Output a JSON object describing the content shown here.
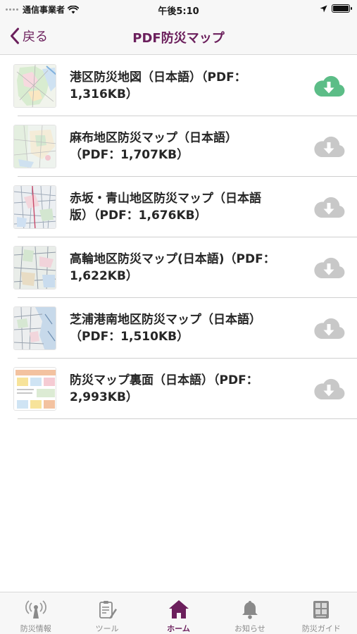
{
  "status_bar": {
    "carrier": "通信事業者",
    "time": "午後5:10"
  },
  "nav": {
    "back_label": "戻る",
    "title": "PDF防災マップ"
  },
  "items": [
    {
      "title_line1": "港区防災地図（日本語）（PDF：",
      "title_line2": "1,316KB）",
      "downloaded": true,
      "thumbnail": "map-thumbnail"
    },
    {
      "title_line1": "麻布地区防災マップ（日本語）",
      "title_line2": "（PDF：1,707KB）",
      "downloaded": false,
      "thumbnail": "map-thumbnail"
    },
    {
      "title_line1": "赤坂・青山地区防災マップ（日本語",
      "title_line2": "版）（PDF：1,676KB）",
      "downloaded": false,
      "thumbnail": "map-thumbnail"
    },
    {
      "title_line1": "高輪地区防災マップ(日本語)（PDF：",
      "title_line2": "1,622KB）",
      "downloaded": false,
      "thumbnail": "map-thumbnail"
    },
    {
      "title_line1": "芝浦港南地区防災マップ（日本語）",
      "title_line2": "（PDF：1,510KB）",
      "downloaded": false,
      "thumbnail": "map-thumbnail"
    },
    {
      "title_line1": "防災マップ裏面（日本語）（PDF：",
      "title_line2": "2,993KB）",
      "downloaded": false,
      "thumbnail": "leaflet-thumbnail"
    }
  ],
  "tabs": [
    {
      "label": "防災情報",
      "icon": "antenna-icon",
      "active": false
    },
    {
      "label": "ツール",
      "icon": "clipboard-pencil-icon",
      "active": false
    },
    {
      "label": "ホーム",
      "icon": "home-icon",
      "active": true
    },
    {
      "label": "お知らせ",
      "icon": "bell-icon",
      "active": false
    },
    {
      "label": "防災ガイド",
      "icon": "guidebook-icon",
      "active": false
    }
  ],
  "colors": {
    "accent": "#6b1f5c",
    "download_done": "#5cbd87",
    "download_pending": "#c8c8c8",
    "tab_inactive": "#8a8a8a"
  }
}
